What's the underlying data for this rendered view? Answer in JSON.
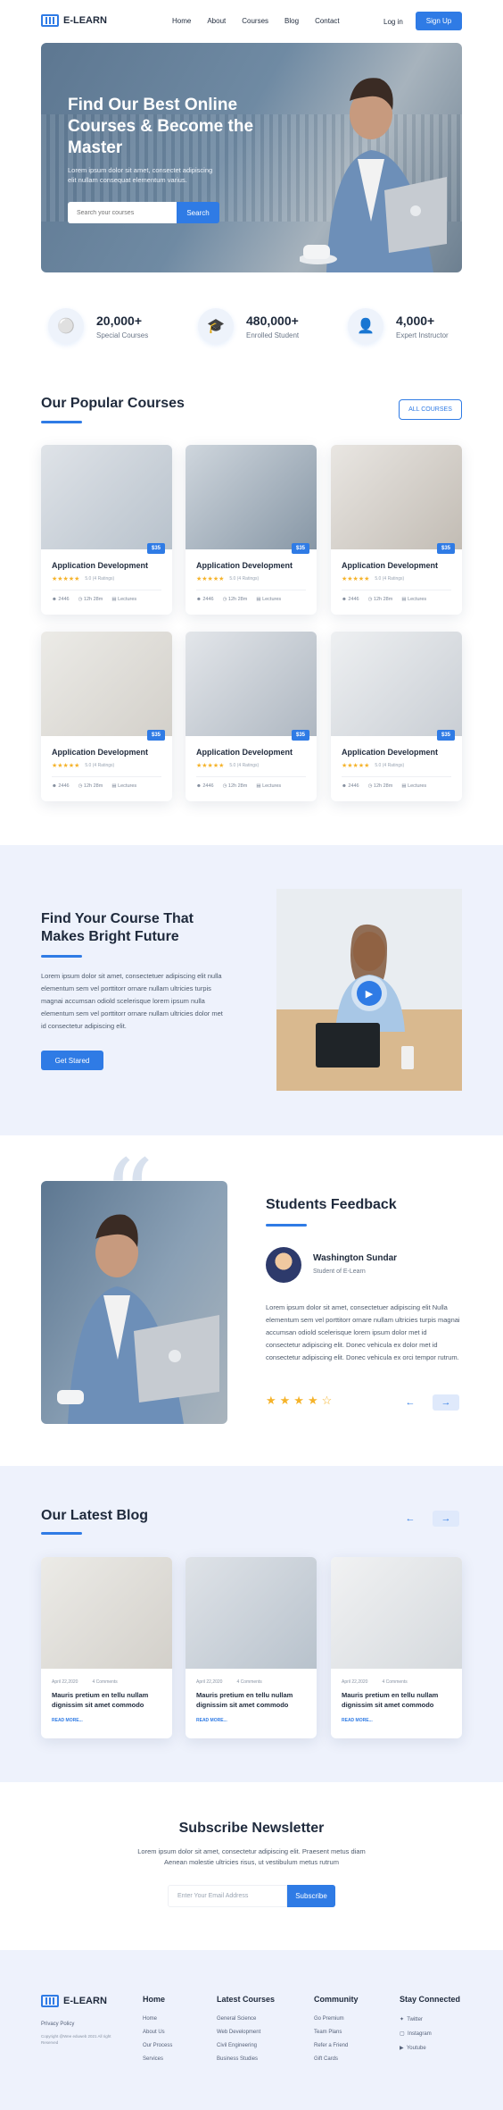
{
  "nav": {
    "logo": "E-LEARN",
    "menu": [
      "Home",
      "About",
      "Courses",
      "Blog",
      "Contact"
    ],
    "login": "Log in",
    "signup": "Sign Up"
  },
  "hero": {
    "title": "Find Our Best Online Courses & Become the Master",
    "text": "Lorem ipsum dolor sit amet, consectet adipiscing elit nullam consequat elementum varius.",
    "search_placeholder": "Search your courses",
    "search_button": "Search"
  },
  "stats": [
    {
      "num": "20,000+",
      "label": "Special Courses",
      "icon": "medal-icon"
    },
    {
      "num": "480,000+",
      "label": "Enrolled Student",
      "icon": "graduate-icon"
    },
    {
      "num": "4,000+",
      "label": "Expert Instructor",
      "icon": "instructor-icon"
    }
  ],
  "courses": {
    "title": "Our Popular Courses",
    "all_button": "ALL COURSES",
    "items": [
      {
        "title": "Application Development",
        "price": "$35",
        "stars": "★★★★★",
        "rating": "5.0 (4 Ratings)",
        "views": "2446",
        "time": "12h 28m",
        "lectures": "Lectures"
      },
      {
        "title": "Application Development",
        "price": "$35",
        "stars": "★★★★★",
        "rating": "5.0 (4 Ratings)",
        "views": "2446",
        "time": "12h 28m",
        "lectures": "Lectures"
      },
      {
        "title": "Application Development",
        "price": "$35",
        "stars": "★★★★★",
        "rating": "5.0 (4 Ratings)",
        "views": "2446",
        "time": "12h 28m",
        "lectures": "Lectures"
      },
      {
        "title": "Application Development",
        "price": "$35",
        "stars": "★★★★★",
        "rating": "5.0 (4 Ratings)",
        "views": "2446",
        "time": "12h 28m",
        "lectures": "Lectures"
      },
      {
        "title": "Application Development",
        "price": "$35",
        "stars": "★★★★★",
        "rating": "5.0 (4 Ratings)",
        "views": "2446",
        "time": "12h 28m",
        "lectures": "Lectures"
      },
      {
        "title": "Application Development",
        "price": "$35",
        "stars": "★★★★★",
        "rating": "5.0 (4 Ratings)",
        "views": "2446",
        "time": "12h 28m",
        "lectures": "Lectures"
      }
    ]
  },
  "future": {
    "title": "Find Your Course That Makes Bright Future",
    "text": "Lorem ipsum dolor sit amet, consectetuer adipiscing elit nulla elementum sem vel porttitorr ornare nullam ultricies turpis magnai accumsan odiold scelerisque lorem ipsum nulla elementum sem vel porttitorr ornare nullam ultricies dolor met id consectetur adipiscing elit.",
    "button": "Get Stared"
  },
  "feedback": {
    "title": "Students Feedback",
    "name": "Washington Sundar",
    "role": "Student of E-Learn",
    "text": "Lorem ipsum dolor sit amet, consectetuer adipiscing elit Nulla elementum sem vel porttitorr ornare nullam ultricies turpis magnai accumsan odiold scelerisque lorem ipsum dolor met id consectetur adipiscing elit. Donec vehicula ex dolor met id consectetur adipiscing elit. Donec vehicula ex orci tempor rutrum.",
    "stars": "★★★★☆"
  },
  "blog": {
    "title": "Our Latest Blog",
    "items": [
      {
        "date": "April 22,2020",
        "comments": "4 Comments",
        "title": "Mauris pretium en tellu nullam dignissim sit amet commodo",
        "read": "READ MORE..."
      },
      {
        "date": "April 22,2020",
        "comments": "4 Comments",
        "title": "Mauris pretium en tellu nullam dignissim sit amet commodo",
        "read": "READ MORE..."
      },
      {
        "date": "April 22,2020",
        "comments": "4 Comments",
        "title": "Mauris pretium en tellu nullam dignissim sit amet commodo",
        "read": "READ MORE..."
      }
    ]
  },
  "newsletter": {
    "title": "Subscribe Newsletter",
    "text": "Lorem ipsum dolor sit amet, consectetur adipiscing elit. Praesent metus diam Aenean molestie ultricies risus, ut vestibulum metus rutrum",
    "placeholder": "Enter Your Email Address",
    "button": "Subscribe"
  },
  "footer": {
    "logo": "E-LEARN",
    "privacy": "Privacy Policy",
    "copyright": "Copyright @Wee eduweb 2021 All right Reserved",
    "home": {
      "title": "Home",
      "items": [
        "Home",
        "About Us",
        "Our Process",
        "Services"
      ]
    },
    "latest": {
      "title": "Latest Courses",
      "items": [
        "General Science",
        "Web Development",
        "Civil Engineering",
        "Business Studies"
      ]
    },
    "community": {
      "title": "Community",
      "items": [
        "Go Premium",
        "Team Plans",
        "Refer a Friend",
        "Gift Cards"
      ]
    },
    "social": {
      "title": "Stay Connected",
      "items": [
        "Twitter",
        "Instagram",
        "Youtube"
      ]
    }
  },
  "colors": {
    "accent": "#2f7be5",
    "soft_bg": "#eef2fc",
    "star": "#f5b32a"
  }
}
